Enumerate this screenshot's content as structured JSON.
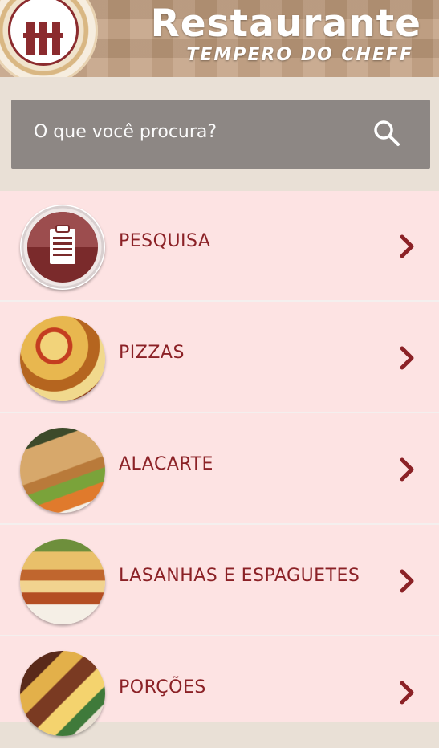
{
  "header": {
    "title": "Restaurante",
    "subtitle": "TEMPERO DO CHEFF"
  },
  "search": {
    "placeholder": "O que você procura?",
    "icon": "search-icon"
  },
  "menu": {
    "items": [
      {
        "label": "PESQUISA",
        "icon": "clipboard-icon"
      },
      {
        "label": "PIZZAS",
        "icon": "pizza-photo"
      },
      {
        "label": "ALACARTE",
        "icon": "grilled-fish-photo"
      },
      {
        "label": "LASANHAS E ESPAGUETES",
        "icon": "lasagna-photo"
      },
      {
        "label": "PORÇÕES",
        "icon": "portions-photo"
      }
    ]
  },
  "colors": {
    "accent": "#8b2126",
    "menu_bg": "#fde3e3",
    "search_bg": "#8d8784"
  }
}
